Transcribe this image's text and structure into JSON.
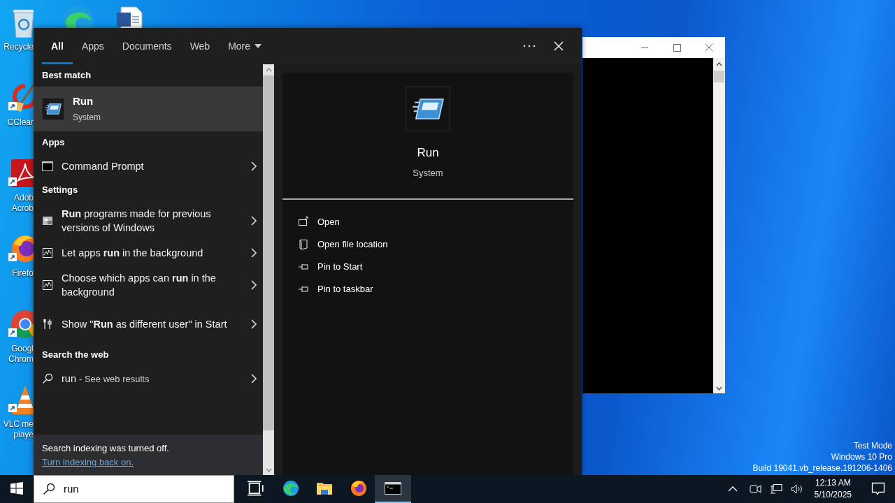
{
  "desktop_icons": [
    {
      "kind": "bin",
      "label_lines": [
        "Recycle"
      ]
    },
    {
      "kind": "broom",
      "label_lines": [
        "CClear"
      ]
    },
    {
      "kind": "pdf",
      "label_lines": [
        "Adob",
        "Acrob"
      ]
    },
    {
      "kind": "fox",
      "label_lines": [
        "Firefo"
      ]
    },
    {
      "kind": "wheel",
      "label_lines": [
        "Googl",
        "Chrom"
      ]
    },
    {
      "kind": "cone",
      "label_lines": [
        "VLC me",
        "playe"
      ]
    }
  ],
  "search_panel": {
    "tabs": [
      {
        "label": "All",
        "selected": true,
        "kind": "tab"
      },
      {
        "label": "Apps",
        "selected": false,
        "kind": "tab"
      },
      {
        "label": "Documents",
        "selected": false,
        "kind": "tab"
      },
      {
        "label": "Web",
        "selected": false,
        "kind": "tab"
      },
      {
        "label": "More",
        "selected": false,
        "kind": "dropdown"
      }
    ],
    "best_match": {
      "heading": "Best match",
      "title": "Run",
      "subtitle": "System",
      "selected": true
    },
    "sections": [
      {
        "heading": "Apps",
        "items": [
          {
            "kind": "console",
            "text": "Command Prompt"
          }
        ]
      },
      {
        "heading": "Settings",
        "items": [
          {
            "kind": "compat",
            "text": "**Run** programs made for previous versions of Windows"
          },
          {
            "kind": "chart",
            "text": "Let apps **run** in the background"
          },
          {
            "kind": "chart",
            "text": "Choose which apps can **run** in the background"
          },
          {
            "kind": "tools",
            "text": "Show \"**Run** as different user\" in Start"
          }
        ]
      },
      {
        "heading": "Search the web",
        "items": [
          {
            "kind": "search",
            "text": "run",
            "hint": "- See web results"
          }
        ]
      }
    ],
    "notice": {
      "text": "Search indexing was turned off.",
      "link": "Turn indexing back on."
    },
    "preview": {
      "title": "Run",
      "subtitle": "System",
      "actions": [
        {
          "kind": "open",
          "label": "Open"
        },
        {
          "kind": "folder",
          "label": "Open file location"
        },
        {
          "kind": "pin",
          "label": "Pin to Start"
        },
        {
          "kind": "pin",
          "label": "Pin to taskbar"
        }
      ]
    }
  },
  "desktop_notice": [
    "Test Mode",
    "Windows 10 Pro",
    "Build 19041.vb_release.191206-1406"
  ],
  "taskbar": {
    "search_value": "run",
    "apps": [
      {
        "kind": "taskview",
        "active": false
      },
      {
        "kind": "swirl",
        "active": false
      },
      {
        "kind": "folder",
        "active": false
      },
      {
        "kind": "fox",
        "active": false
      },
      {
        "kind": "console",
        "active": true
      }
    ],
    "time": "12:13 AM",
    "date": "5/10/2025"
  }
}
